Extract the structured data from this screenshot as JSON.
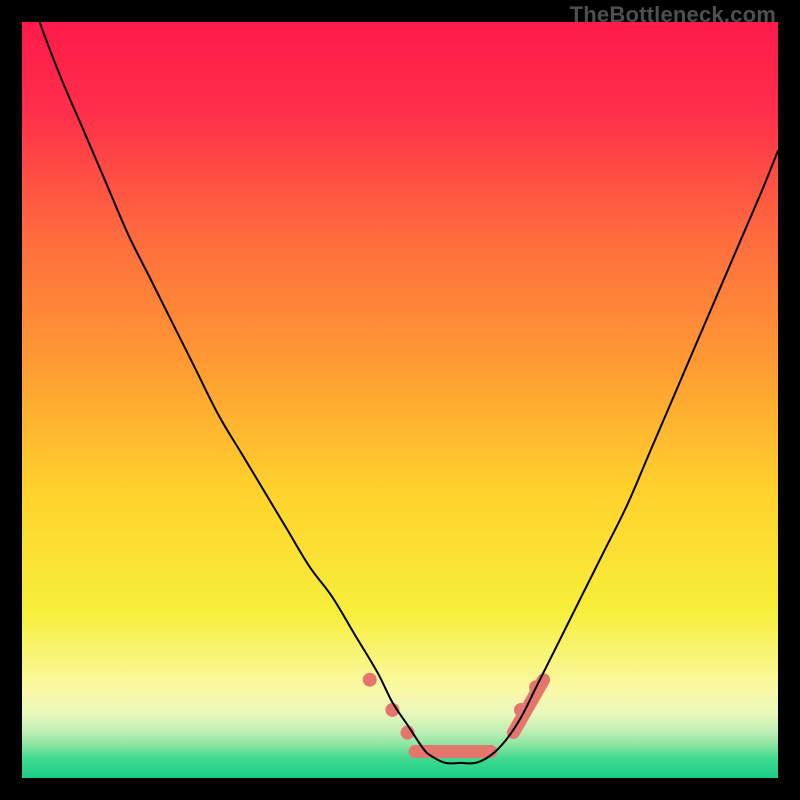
{
  "watermark": "TheBottleneck.com",
  "chart_data": {
    "type": "line",
    "title": "",
    "xlabel": "",
    "ylabel": "",
    "xlim": [
      0,
      100
    ],
    "ylim": [
      0,
      100
    ],
    "grid": false,
    "legend": false,
    "background": {
      "gradient_stops": [
        {
          "pos": 0.0,
          "color": "#ff1a4b"
        },
        {
          "pos": 0.12,
          "color": "#ff2f4a"
        },
        {
          "pos": 0.28,
          "color": "#ff6a3e"
        },
        {
          "pos": 0.45,
          "color": "#ff9a33"
        },
        {
          "pos": 0.62,
          "color": "#ffd22c"
        },
        {
          "pos": 0.78,
          "color": "#f7ef3a"
        },
        {
          "pos": 0.885,
          "color": "#faf9a8"
        },
        {
          "pos": 0.915,
          "color": "#e9f7bb"
        },
        {
          "pos": 0.935,
          "color": "#c6efb6"
        },
        {
          "pos": 0.955,
          "color": "#8fe6a3"
        },
        {
          "pos": 0.975,
          "color": "#3fd990"
        },
        {
          "pos": 1.0,
          "color": "#17cf85"
        }
      ]
    },
    "series": [
      {
        "name": "bottleneck-curve",
        "color": "#000000",
        "width": 2,
        "x": [
          0,
          2,
          5,
          8,
          11,
          14,
          17,
          20,
          23,
          26,
          29,
          32,
          35,
          38,
          41,
          44,
          47,
          49,
          51,
          53,
          54,
          56,
          58,
          60,
          62,
          64,
          66,
          68,
          71,
          74,
          77,
          80,
          83,
          86,
          89,
          92,
          95,
          98,
          100
        ],
        "y": [
          108,
          101,
          93,
          86,
          79,
          72,
          66,
          60,
          54,
          48,
          43,
          38,
          33,
          28,
          24,
          19,
          14,
          10,
          7,
          4,
          3,
          2,
          2,
          2,
          3,
          5,
          8,
          12,
          18,
          24,
          30,
          36,
          43,
          50,
          57,
          64,
          71,
          78,
          83
        ]
      }
    ],
    "markers": {
      "color": "#e4766e",
      "radius": 7,
      "points": [
        {
          "x": 46,
          "y": 13
        },
        {
          "x": 49,
          "y": 9
        },
        {
          "x": 51,
          "y": 6
        },
        {
          "x": 66,
          "y": 9
        },
        {
          "x": 68,
          "y": 12
        }
      ],
      "segments": [
        {
          "x1": 52,
          "y1": 3.5,
          "x2": 62,
          "y2": 3.5,
          "width": 13
        },
        {
          "x1": 65,
          "y1": 6,
          "x2": 69,
          "y2": 13,
          "width": 13
        }
      ]
    }
  }
}
